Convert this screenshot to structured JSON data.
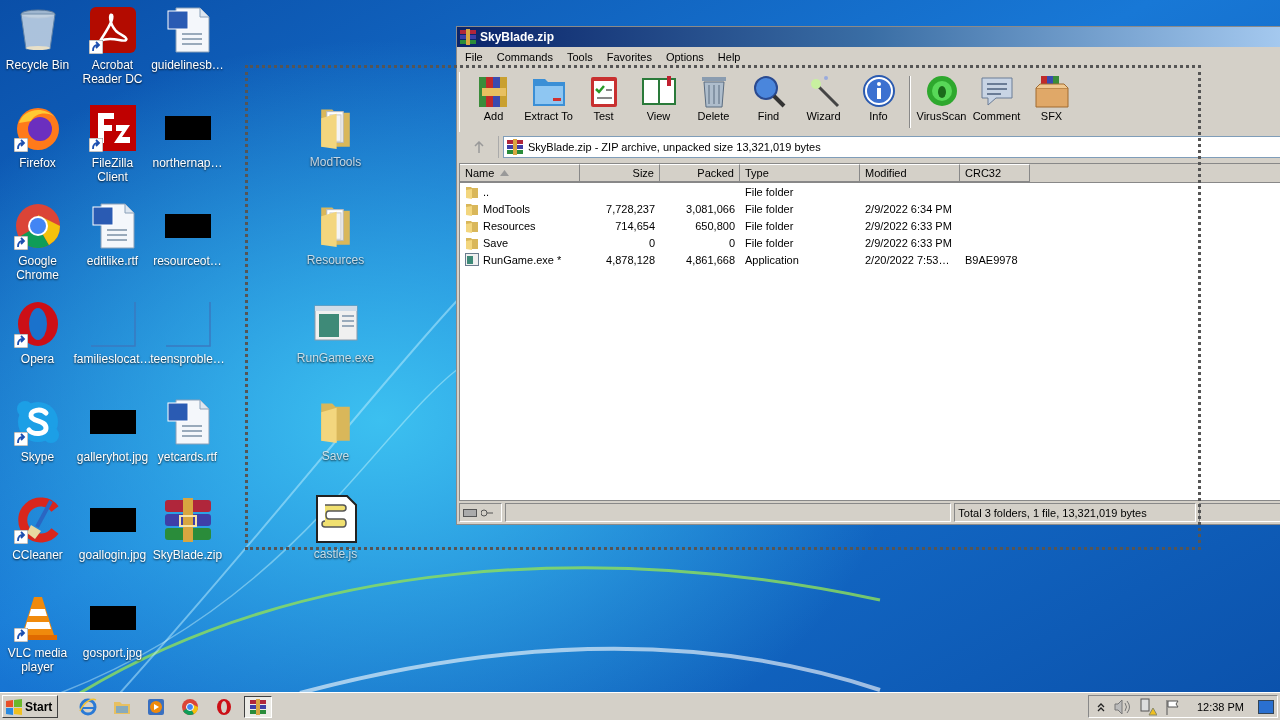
{
  "desktop_icons": [
    {
      "label": "Recycle Bin",
      "kind": "recycle",
      "shortcut": false
    },
    {
      "label": "Firefox",
      "kind": "firefox",
      "shortcut": true
    },
    {
      "label": "Google Chrome",
      "kind": "chrome",
      "shortcut": true
    },
    {
      "label": "Opera",
      "kind": "opera",
      "shortcut": true
    },
    {
      "label": "Skype",
      "kind": "skype",
      "shortcut": true
    },
    {
      "label": "CCleaner",
      "kind": "ccleaner",
      "shortcut": true
    },
    {
      "label": "VLC media player",
      "kind": "vlc",
      "shortcut": true
    },
    {
      "label": "Acrobat Reader DC",
      "kind": "acrobat",
      "shortcut": true
    },
    {
      "label": "FileZilla Client",
      "kind": "filezilla",
      "shortcut": true
    },
    {
      "label": "editlike.rtf",
      "kind": "word",
      "shortcut": false
    },
    {
      "label": "familieslocat…",
      "kind": "blank",
      "shortcut": false
    },
    {
      "label": "galleryhot.jpg",
      "kind": "thumbnail",
      "shortcut": false
    },
    {
      "label": "goallogin.jpg",
      "kind": "thumbnail",
      "shortcut": false
    },
    {
      "label": "gosport.jpg",
      "kind": "thumbnail",
      "shortcut": false
    },
    {
      "label": "guidelinesb…",
      "kind": "word",
      "shortcut": false
    },
    {
      "label": "northernap…",
      "kind": "thumbnail",
      "shortcut": false
    },
    {
      "label": "resourceot…",
      "kind": "thumbnail",
      "shortcut": false
    },
    {
      "label": "teensproble…",
      "kind": "blank",
      "shortcut": false
    },
    {
      "label": "yetcards.rtf",
      "kind": "word",
      "shortcut": false
    },
    {
      "label": "SkyBlade.zip",
      "kind": "winrar",
      "shortcut": false
    }
  ],
  "dragged_icons": [
    {
      "label": "ModTools",
      "kind": "folder_full"
    },
    {
      "label": "Resources",
      "kind": "folder_full"
    },
    {
      "label": "RunGame.exe",
      "kind": "exe"
    },
    {
      "label": "Save",
      "kind": "folder"
    },
    {
      "label": "castle.js",
      "kind": "script"
    }
  ],
  "window": {
    "title": "SkyBlade.zip",
    "menu": [
      "File",
      "Commands",
      "Tools",
      "Favorites",
      "Options",
      "Help"
    ],
    "toolbar": [
      {
        "label": "Add",
        "kind": "add"
      },
      {
        "label": "Extract To",
        "kind": "extract"
      },
      {
        "label": "Test",
        "kind": "test"
      },
      {
        "label": "View",
        "kind": "view"
      },
      {
        "label": "Delete",
        "kind": "delete"
      },
      {
        "label": "Find",
        "kind": "find"
      },
      {
        "label": "Wizard",
        "kind": "wizard"
      },
      {
        "label": "Info",
        "kind": "info"
      },
      {
        "label": "VirusScan",
        "kind": "virusscan"
      },
      {
        "label": "Comment",
        "kind": "comment"
      },
      {
        "label": "SFX",
        "kind": "sfx"
      }
    ],
    "address": "SkyBlade.zip - ZIP archive, unpacked size 13,321,019 bytes",
    "columns": [
      "Name",
      "Size",
      "Packed",
      "Type",
      "Modified",
      "CRC32"
    ],
    "rows": [
      {
        "kind": "folder",
        "name": "..",
        "size": "",
        "packed": "",
        "type": "File folder",
        "modified": "",
        "crc32": ""
      },
      {
        "kind": "folder",
        "name": "ModTools",
        "size": "7,728,237",
        "packed": "3,081,066",
        "type": "File folder",
        "modified": "2/9/2022 6:34 PM",
        "crc32": ""
      },
      {
        "kind": "folder",
        "name": "Resources",
        "size": "714,654",
        "packed": "650,800",
        "type": "File folder",
        "modified": "2/9/2022 6:33 PM",
        "crc32": ""
      },
      {
        "kind": "folder",
        "name": "Save",
        "size": "0",
        "packed": "0",
        "type": "File folder",
        "modified": "2/9/2022 6:33 PM",
        "crc32": ""
      },
      {
        "kind": "exe",
        "name": "RunGame.exe *",
        "size": "4,878,128",
        "packed": "4,861,668",
        "type": "Application",
        "modified": "2/20/2022 7:53…",
        "crc32": "B9AE9978"
      }
    ],
    "status": "Total 3 folders, 1 file, 13,321,019 bytes"
  },
  "taskbar": {
    "start": "Start",
    "quick_launch": [
      {
        "kind": "ie"
      },
      {
        "kind": "explorer"
      },
      {
        "kind": "media"
      },
      {
        "kind": "chrome"
      },
      {
        "kind": "opera"
      }
    ],
    "tasks": [
      {
        "kind": "winrar",
        "selected": true
      }
    ],
    "clock": "12:38 PM"
  }
}
